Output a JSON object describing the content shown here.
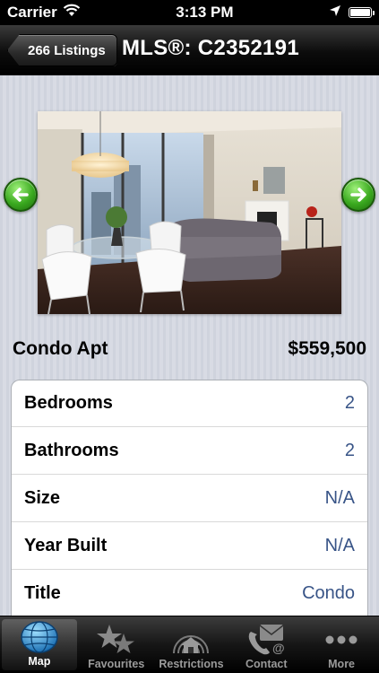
{
  "status_bar": {
    "carrier": "Carrier",
    "time": "3:13 PM",
    "battery_level": 1.0
  },
  "nav": {
    "back_label": "266 Listings",
    "title": "MLS®: C2352191"
  },
  "listing": {
    "photo_icon": "condo-living-room-photo",
    "type": "Condo Apt",
    "price": "$559,500",
    "details": [
      {
        "label": "Bedrooms",
        "value": "2"
      },
      {
        "label": "Bathrooms",
        "value": "2"
      },
      {
        "label": "Size",
        "value": "N/A"
      },
      {
        "label": "Year Built",
        "value": "N/A"
      },
      {
        "label": "Title",
        "value": "Condo"
      }
    ]
  },
  "tabs": [
    {
      "label": "Map",
      "icon": "globe-icon",
      "active": true
    },
    {
      "label": "Favourites",
      "icon": "stars-icon",
      "active": false
    },
    {
      "label": "Restrictions",
      "icon": "house-signal-icon",
      "active": false
    },
    {
      "label": "Contact",
      "icon": "phone-mail-icon",
      "active": false
    },
    {
      "label": "More",
      "icon": "more-dots-icon",
      "active": false
    }
  ],
  "colors": {
    "accent_value": "#385487",
    "arrow_green": "#3aa91f"
  }
}
